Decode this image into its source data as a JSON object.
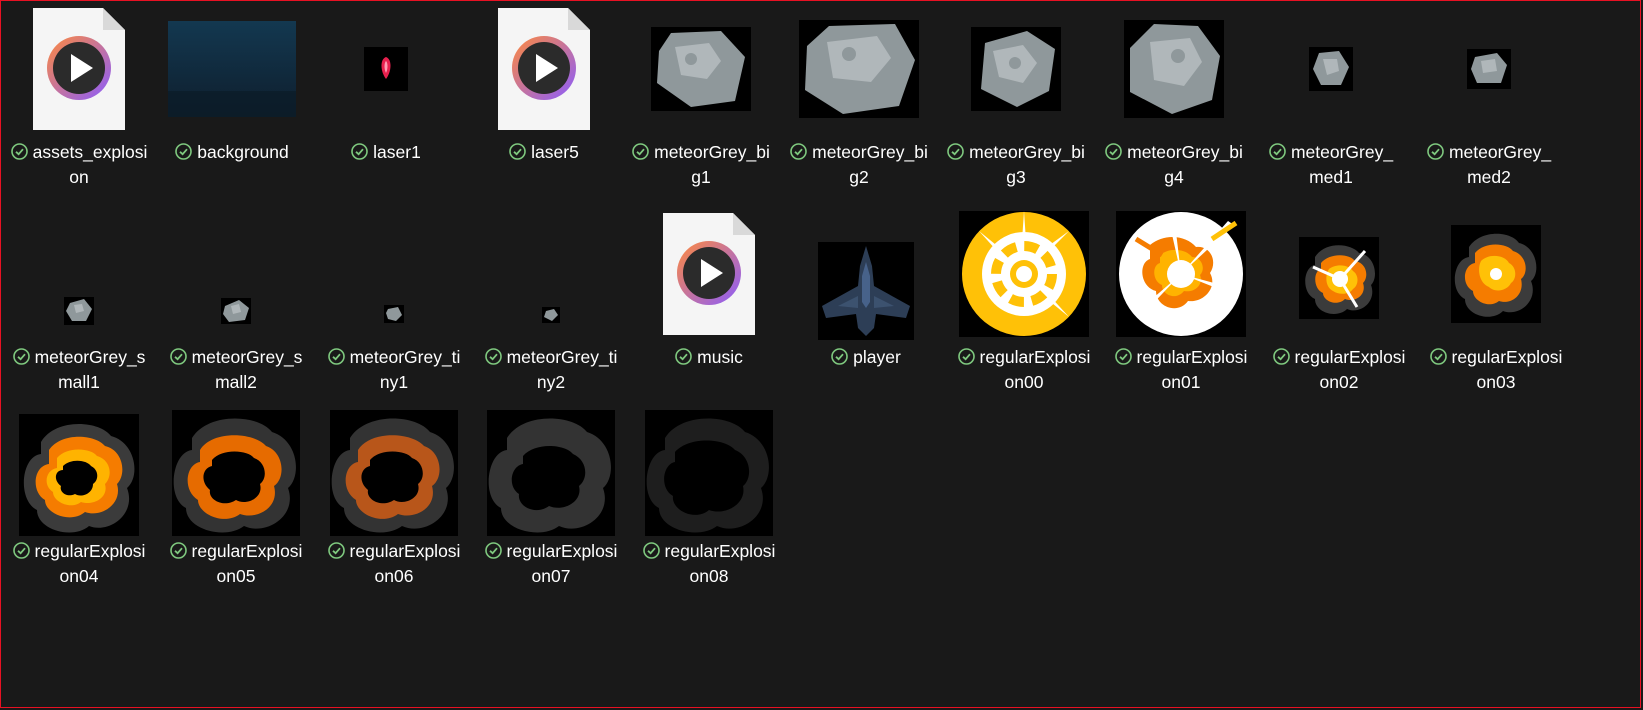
{
  "files": [
    {
      "name": "assets_explosion",
      "kind": "video",
      "sync": "check-circle-icon"
    },
    {
      "name": "background",
      "kind": "background",
      "sync": "check-circle-icon"
    },
    {
      "name": "laser1",
      "kind": "laser",
      "sync": "check-circle-icon"
    },
    {
      "name": "laser5",
      "kind": "video",
      "sync": "check-circle-icon"
    },
    {
      "name": "meteorGrey_big1",
      "kind": "meteor",
      "sync": "check-circle-icon"
    },
    {
      "name": "meteorGrey_big2",
      "kind": "meteor",
      "sync": "check-circle-icon"
    },
    {
      "name": "meteorGrey_big3",
      "kind": "meteor",
      "sync": "check-circle-icon"
    },
    {
      "name": "meteorGrey_big4",
      "kind": "meteor",
      "sync": "check-circle-icon"
    },
    {
      "name": "meteorGrey_med1",
      "kind": "meteor",
      "sync": "check-circle-icon"
    },
    {
      "name": "meteorGrey_med2",
      "kind": "meteor",
      "sync": "check-circle-icon"
    },
    {
      "name": "meteorGrey_small1",
      "kind": "meteor",
      "sync": "check-circle-icon"
    },
    {
      "name": "meteorGrey_small2",
      "kind": "meteor",
      "sync": "check-circle-icon"
    },
    {
      "name": "meteorGrey_tiny1",
      "kind": "meteor",
      "sync": "check-circle-icon"
    },
    {
      "name": "meteorGrey_tiny2",
      "kind": "meteor",
      "sync": "check-circle-icon"
    },
    {
      "name": "music",
      "kind": "video",
      "sync": "check-circle-icon"
    },
    {
      "name": "player",
      "kind": "ship",
      "sync": "check-circle-icon"
    },
    {
      "name": "regularExplosion00",
      "kind": "explosion",
      "sync": "check-circle-icon"
    },
    {
      "name": "regularExplosion01",
      "kind": "explosion",
      "sync": "check-circle-icon"
    },
    {
      "name": "regularExplosion02",
      "kind": "explosion",
      "sync": "check-circle-icon"
    },
    {
      "name": "regularExplosion03",
      "kind": "explosion",
      "sync": "check-circle-icon"
    },
    {
      "name": "regularExplosion04",
      "kind": "explosion",
      "sync": "check-circle-icon"
    },
    {
      "name": "regularExplosion05",
      "kind": "explosion",
      "sync": "check-circle-icon"
    },
    {
      "name": "regularExplosion06",
      "kind": "explosion",
      "sync": "check-circle-icon"
    },
    {
      "name": "regularExplosion07",
      "kind": "explosion",
      "sync": "check-circle-icon"
    },
    {
      "name": "regularExplosion08",
      "kind": "explosion",
      "sync": "check-circle-icon"
    }
  ],
  "colors": {
    "background": "#191919",
    "selection_border": "#e81123",
    "sync_ok": "#7fc97f",
    "meteor": "#8f989b",
    "explosion_yellow": "#ffc107",
    "explosion_orange": "#f57c00"
  }
}
